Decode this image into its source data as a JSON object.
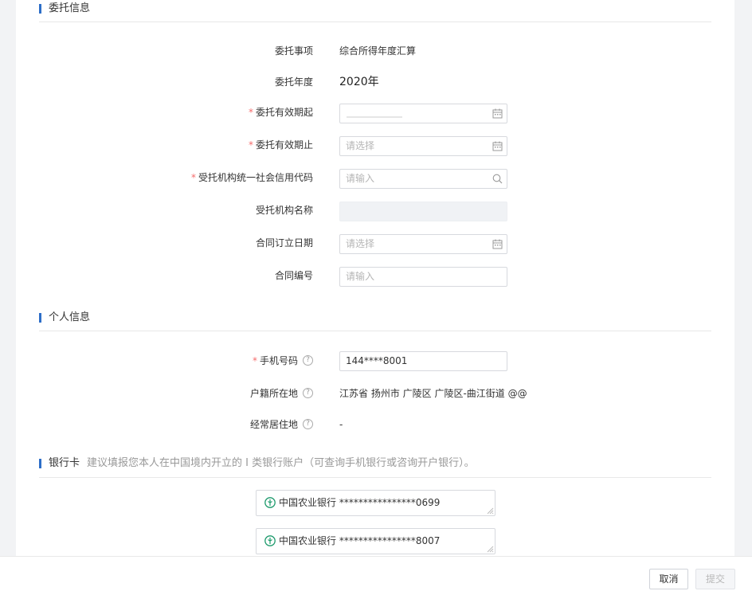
{
  "sections": {
    "entrust": "委托信息",
    "personal": "个人信息",
    "bank": "银行卡",
    "bank_hint": "建议填报您本人在中国境内开立的 I 类银行账户（可查询手机银行或咨询开户银行）。"
  },
  "entrust": {
    "matter_label": "委托事项",
    "matter_value": "综合所得年度汇算",
    "year_label": "委托年度",
    "year_value": "2020年",
    "start_label": "委托有效期起",
    "end_label": "委托有效期止",
    "end_placeholder": "请选择",
    "credit_code_label": "受托机构统一社会信用代码",
    "credit_code_placeholder": "请输入",
    "org_name_label": "受托机构名称",
    "contract_date_label": "合同订立日期",
    "contract_date_placeholder": "请选择",
    "contract_no_label": "合同编号",
    "contract_no_placeholder": "请输入"
  },
  "personal": {
    "phone_label": "手机号码",
    "phone_value": "144****8001",
    "household_label": "户籍所在地",
    "household_value": "江苏省 扬州市 广陵区 广陵区-曲江街道 @@",
    "residence_label": "经常居住地",
    "residence_value": "-"
  },
  "bank_cards": [
    {
      "bank": "中国农业银行",
      "number": "****************0699"
    },
    {
      "bank": "中国农业银行",
      "number": "****************8007"
    }
  ],
  "required_mark": "*",
  "help_mark": "?",
  "footer": {
    "cancel": "取消",
    "submit": "提交"
  },
  "colors": {
    "accent": "#2d6ec8",
    "required": "#f56c6c",
    "bank_logo": "#1d9a6c"
  },
  "icons": {
    "date": "calendar-icon",
    "search": "search-icon",
    "help": "question-circle-icon",
    "bank": "abc-bank-logo"
  }
}
